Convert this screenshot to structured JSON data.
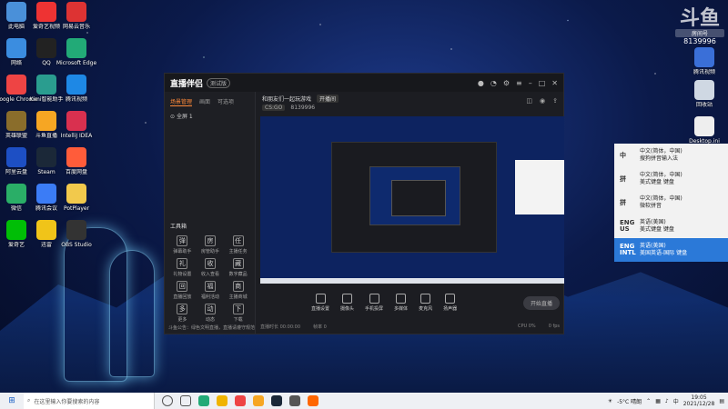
{
  "desktop_left": [
    {
      "label": "此电脑",
      "color": "#4a90d9"
    },
    {
      "label": "爱奇艺视频",
      "color": "#e33"
    },
    {
      "label": "网易云音乐",
      "color": "#d33"
    },
    {
      "label": "网络",
      "color": "#3b8de0"
    },
    {
      "label": "QQ",
      "color": "#222"
    },
    {
      "label": "Microsoft Edge",
      "color": "#2a7"
    },
    {
      "label": "Google Chrome",
      "color": "#e44"
    },
    {
      "label": "Kimi智能助手",
      "color": "#2a9d8f"
    },
    {
      "label": "腾讯视频",
      "color": "#1e88e5"
    },
    {
      "label": "英雄联盟",
      "color": "#8a6d2b"
    },
    {
      "label": "斗鱼直播",
      "color": "#f6a623"
    },
    {
      "label": "IntelliJ IDEA",
      "color": "#d9304f"
    },
    {
      "label": "阿里云盘",
      "color": "#1d4fc4"
    },
    {
      "label": "Steam",
      "color": "#1b2838"
    },
    {
      "label": "百度网盘",
      "color": "#ff5c3a"
    },
    {
      "label": "微信",
      "color": "#2aae67"
    },
    {
      "label": "腾讯会议",
      "color": "#3b7cf6"
    },
    {
      "label": "PotPlayer",
      "color": "#f2c94c"
    },
    {
      "label": "爱奇艺",
      "color": "#00be06"
    },
    {
      "label": "迅雷",
      "color": "#f0c419"
    },
    {
      "label": "OBS Studio",
      "color": "#333"
    }
  ],
  "desktop_right": [
    {
      "label": "腾讯视频",
      "color": "#3a6fd8"
    },
    {
      "label": "回收站",
      "color": "#cfd8e3"
    },
    {
      "label": "Desktop.ini",
      "color": "#eee"
    }
  ],
  "brand": {
    "big": "斗鱼",
    "room": "房间号",
    "number": "8139996"
  },
  "app": {
    "title": "直播伴侣",
    "version": "测试版",
    "sidebar_tabs": [
      "场景管理",
      "画面",
      "可选项"
    ],
    "scene": "全屏 1",
    "tools_title": "工具箱",
    "tools": [
      {
        "label": "弹幕助手",
        "icon": "弹"
      },
      {
        "label": "房管助手",
        "icon": "房"
      },
      {
        "label": "主播任务",
        "icon": "任"
      },
      {
        "label": "礼物设置",
        "icon": "礼"
      },
      {
        "label": "收入查看",
        "icon": "收"
      },
      {
        "label": "数字藏品",
        "icon": "藏"
      },
      {
        "label": "直播回放",
        "icon": "回"
      },
      {
        "label": "福利活动",
        "icon": "福"
      },
      {
        "label": "主播商城",
        "icon": "商"
      },
      {
        "label": "更多",
        "icon": "多"
      },
      {
        "label": "动态",
        "icon": "动"
      },
      {
        "label": "下载",
        "icon": "下"
      }
    ],
    "notice": "斗鱼公告：绿色文明直播，直播请遵守规范，禁止一切违规行为",
    "stream_title": "和朋友们一起玩游戏",
    "category": "CS:GO",
    "room_chip": "开播间",
    "viewers": "8139996",
    "bottom_buttons": [
      "直播设置",
      "摄像头",
      "手机投屏",
      "多媒体",
      "麦克风",
      "扬声器"
    ],
    "start_label": "开始直播",
    "status": {
      "left": "直播时长 00:00:00",
      "mid": "帧率 0",
      "right": "CPU 0%",
      "far": "0 fps"
    }
  },
  "ime": [
    {
      "code": "中",
      "desc1": "中文(简体，中国)",
      "desc2": "搜狗拼音输入法"
    },
    {
      "code": "拼",
      "desc1": "中文(简体，中国)",
      "desc2": "美式键盘 键盘"
    },
    {
      "code": "拼",
      "desc1": "中文(简体，中国)",
      "desc2": "微软拼音"
    },
    {
      "code": "ENG US",
      "desc1": "英语(美国)",
      "desc2": "美式键盘 键盘"
    },
    {
      "code": "ENG INTL",
      "desc1": "英语(美国)",
      "desc2": "美国英语-国际 键盘"
    }
  ],
  "taskbar": {
    "search_placeholder": "在这里输入你要搜索的内容",
    "weather": "-5°C 晴朗",
    "lang": "中",
    "time": "19:05",
    "date": "2021/12/28"
  }
}
